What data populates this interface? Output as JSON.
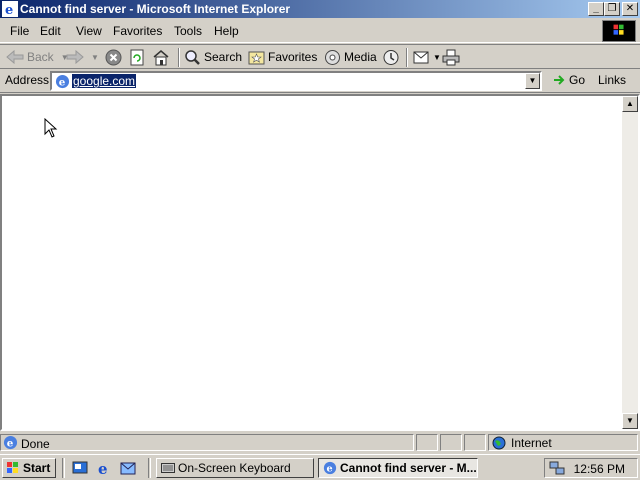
{
  "window": {
    "title": "Cannot find server - Microsoft Internet Explorer",
    "minimize": "_",
    "maximize": "❐",
    "close": "✕"
  },
  "menu": [
    "File",
    "Edit",
    "View",
    "Favorites",
    "Tools",
    "Help"
  ],
  "toolbar": {
    "back": "Back",
    "search": "Search",
    "favorites": "Favorites",
    "media": "Media"
  },
  "address": {
    "label": "Address",
    "value": "google.com",
    "go": "Go",
    "links": "Links"
  },
  "status": {
    "text": "Done",
    "zone": "Internet"
  },
  "taskbar": {
    "start": "Start",
    "tasks": [
      "On-Screen Keyboard",
      "Cannot find server - M..."
    ],
    "clock": "12:56 PM"
  },
  "icons": [
    "ie-icon",
    "back-arrow-icon",
    "forward-arrow-icon",
    "stop-icon",
    "refresh-icon",
    "home-icon",
    "search-icon",
    "favorites-icon",
    "media-icon",
    "history-icon",
    "mail-icon",
    "print-icon",
    "go-icon",
    "status-ie-icon",
    "internet-globe-icon",
    "windows-flag-icon",
    "keyboard-icon",
    "network-icon"
  ]
}
